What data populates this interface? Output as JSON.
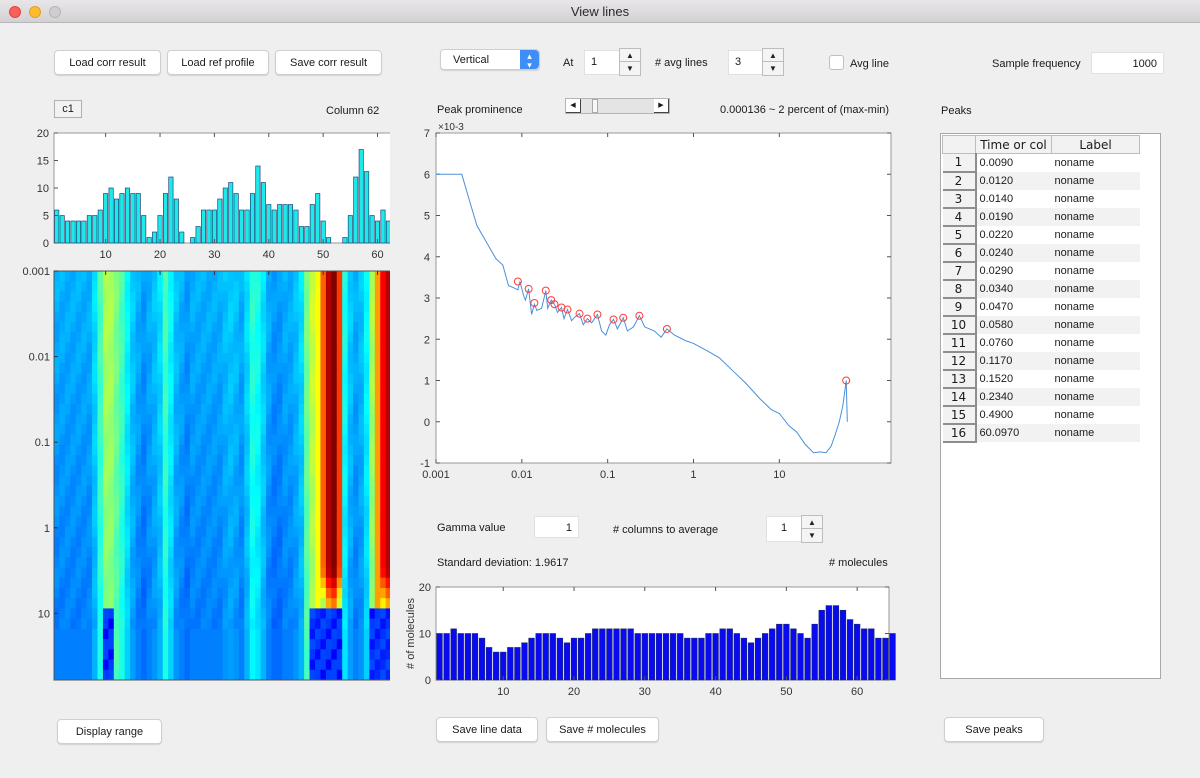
{
  "window": {
    "title": "View lines"
  },
  "toolbar": {
    "load_corr_label": "Load corr result",
    "load_ref_label": "Load ref profile",
    "save_corr_label": "Save corr result",
    "direction_select": "Vertical",
    "at_label": "At",
    "at_value": "1",
    "avg_lines_label": "# avg lines",
    "avg_lines_value": "3",
    "avg_line_checkbox_label": "Avg line",
    "avg_line_checked": false,
    "sample_freq_label": "Sample frequency",
    "sample_freq_value": "1000"
  },
  "left_panel": {
    "channel_badge": "c1",
    "column_label": "Column 62",
    "display_range_label": "Display range"
  },
  "middle_panel": {
    "peak_prominence_label": "Peak prominence",
    "peak_prominence_slider_fraction": 0.15,
    "prominence_readout": "0.000136 ~ 2 percent of (max-min)",
    "gamma_label": "Gamma value",
    "gamma_value": "1",
    "columns_avg_label": "# columns to average",
    "columns_avg_value": "1",
    "std_label": "Standard deviation: 1.9617",
    "molecules_label": "# molecules",
    "save_line_data_label": "Save line data",
    "save_molecules_label": "Save # molecules"
  },
  "peaks_panel": {
    "title": "Peaks",
    "columns": [
      "Time or col",
      "Label"
    ],
    "rows": [
      {
        "n": "1",
        "time": "0.0090",
        "label": "noname"
      },
      {
        "n": "2",
        "time": "0.0120",
        "label": "noname"
      },
      {
        "n": "3",
        "time": "0.0140",
        "label": "noname"
      },
      {
        "n": "4",
        "time": "0.0190",
        "label": "noname"
      },
      {
        "n": "5",
        "time": "0.0220",
        "label": "noname"
      },
      {
        "n": "6",
        "time": "0.0240",
        "label": "noname"
      },
      {
        "n": "7",
        "time": "0.0290",
        "label": "noname"
      },
      {
        "n": "8",
        "time": "0.0340",
        "label": "noname"
      },
      {
        "n": "9",
        "time": "0.0470",
        "label": "noname"
      },
      {
        "n": "10",
        "time": "0.0580",
        "label": "noname"
      },
      {
        "n": "11",
        "time": "0.0760",
        "label": "noname"
      },
      {
        "n": "12",
        "time": "0.1170",
        "label": "noname"
      },
      {
        "n": "13",
        "time": "0.1520",
        "label": "noname"
      },
      {
        "n": "14",
        "time": "0.2340",
        "label": "noname"
      },
      {
        "n": "15",
        "time": "0.4900",
        "label": "noname"
      },
      {
        "n": "16",
        "time": "60.0970",
        "label": "noname"
      }
    ],
    "save_peaks_label": "Save peaks"
  },
  "chart_data": [
    {
      "id": "top-histogram",
      "type": "bar",
      "title": "",
      "xlabel": "",
      "ylabel": "",
      "xlim": [
        0.5,
        64.5
      ],
      "ylim": [
        0,
        20
      ],
      "xticks": [
        10,
        20,
        30,
        40,
        50,
        60
      ],
      "yticks": [
        0,
        5,
        10,
        15,
        20
      ],
      "color": "#1ee8e8",
      "values": [
        6,
        5,
        4,
        4,
        4,
        4,
        5,
        5,
        6,
        9,
        10,
        8,
        9,
        10,
        9,
        9,
        5,
        1,
        2,
        5,
        9,
        12,
        8,
        2,
        0,
        1,
        3,
        6,
        6,
        6,
        8,
        10,
        11,
        9,
        6,
        6,
        9,
        14,
        11,
        7,
        6,
        7,
        7,
        7,
        6,
        3,
        3,
        7,
        9,
        4,
        1,
        0,
        0,
        1,
        5,
        12,
        17,
        13,
        5,
        4,
        6,
        4,
        4,
        8,
        12
      ]
    },
    {
      "id": "heatmap",
      "type": "heatmap",
      "colormap": "jet",
      "xlim": [
        0.5,
        64.5
      ],
      "xticks": [
        10,
        20,
        30,
        40,
        50,
        60
      ],
      "ylabel": "",
      "yscale": "log",
      "yticks": [
        "0.001",
        "0.01",
        "0.1",
        "1",
        "10"
      ],
      "ylim": [
        0.001,
        60
      ],
      "column_profile": [
        0.3,
        0.3,
        0.3,
        0.3,
        0.3,
        0.3,
        0.3,
        0.35,
        0.45,
        0.55,
        0.55,
        0.5,
        0.45,
        0.38,
        0.33,
        0.3,
        0.28,
        0.3,
        0.32,
        0.35,
        0.45,
        0.38,
        0.32,
        0.3,
        0.28,
        0.3,
        0.3,
        0.3,
        0.3,
        0.3,
        0.3,
        0.32,
        0.33,
        0.32,
        0.3,
        0.35,
        0.42,
        0.4,
        0.35,
        0.3,
        0.28,
        0.28,
        0.3,
        0.3,
        0.32,
        0.35,
        0.5,
        0.58,
        0.62,
        0.78,
        0.95,
        1.0,
        0.82,
        0.4,
        0.33,
        0.3,
        0.32,
        0.38,
        0.55,
        0.72,
        0.88,
        0.95,
        0.9,
        0.8
      ]
    },
    {
      "id": "line-profile",
      "type": "line",
      "xscale": "log",
      "xlim": [
        0.001,
        200
      ],
      "ylim": [
        -1,
        7
      ],
      "y_multiplier": "×10^-3",
      "xticks": [
        "0.001",
        "0.01",
        "0.1",
        "1",
        "10"
      ],
      "yticks": [
        -1,
        0,
        1,
        2,
        3,
        4,
        5,
        6,
        7
      ],
      "line_color": "#4a90d9",
      "marker_color": "#ff3b3b",
      "points": [
        [
          0.001,
          6.0
        ],
        [
          0.002,
          6.0
        ],
        [
          0.0025,
          5.3
        ],
        [
          0.003,
          4.75
        ],
        [
          0.004,
          4.3
        ],
        [
          0.005,
          3.95
        ],
        [
          0.006,
          3.8
        ],
        [
          0.007,
          3.3
        ],
        [
          0.008,
          3.25
        ],
        [
          0.009,
          3.2
        ],
        [
          0.0095,
          3.4
        ],
        [
          0.0105,
          3.05
        ],
        [
          0.011,
          2.95
        ],
        [
          0.012,
          3.22
        ],
        [
          0.013,
          2.6
        ],
        [
          0.014,
          2.85
        ],
        [
          0.015,
          2.7
        ],
        [
          0.017,
          2.75
        ],
        [
          0.019,
          3.18
        ],
        [
          0.02,
          2.75
        ],
        [
          0.022,
          2.95
        ],
        [
          0.024,
          2.85
        ],
        [
          0.026,
          2.65
        ],
        [
          0.029,
          2.77
        ],
        [
          0.031,
          2.5
        ],
        [
          0.034,
          2.72
        ],
        [
          0.038,
          2.45
        ],
        [
          0.042,
          2.55
        ],
        [
          0.047,
          2.62
        ],
        [
          0.052,
          2.35
        ],
        [
          0.058,
          2.5
        ],
        [
          0.065,
          2.4
        ],
        [
          0.076,
          2.6
        ],
        [
          0.085,
          2.2
        ],
        [
          0.095,
          2.1
        ],
        [
          0.105,
          2.35
        ],
        [
          0.117,
          2.48
        ],
        [
          0.13,
          2.25
        ],
        [
          0.152,
          2.52
        ],
        [
          0.17,
          2.2
        ],
        [
          0.2,
          2.3
        ],
        [
          0.234,
          2.57
        ],
        [
          0.27,
          2.3
        ],
        [
          0.35,
          2.2
        ],
        [
          0.42,
          2.05
        ],
        [
          0.49,
          2.25
        ],
        [
          0.6,
          2.1
        ],
        [
          0.8,
          1.97
        ],
        [
          1.0,
          1.9
        ],
        [
          1.5,
          1.7
        ],
        [
          2.0,
          1.55
        ],
        [
          3.0,
          1.2
        ],
        [
          4.0,
          0.95
        ],
        [
          6.0,
          0.55
        ],
        [
          8.0,
          0.3
        ],
        [
          10.0,
          0.2
        ],
        [
          13.0,
          -0.1
        ],
        [
          16.0,
          -0.25
        ],
        [
          20.0,
          -0.55
        ],
        [
          25.0,
          -0.75
        ],
        [
          30.0,
          -0.73
        ],
        [
          35.0,
          -0.75
        ],
        [
          40.0,
          -0.6
        ],
        [
          45.0,
          -0.3
        ],
        [
          50.0,
          0.0
        ],
        [
          55.0,
          0.4
        ],
        [
          60.1,
          1.0
        ],
        [
          62.0,
          0.0
        ]
      ],
      "peaks": [
        [
          0.009,
          3.4
        ],
        [
          0.012,
          3.22
        ],
        [
          0.014,
          2.88
        ],
        [
          0.019,
          3.18
        ],
        [
          0.022,
          2.95
        ],
        [
          0.024,
          2.85
        ],
        [
          0.029,
          2.77
        ],
        [
          0.034,
          2.72
        ],
        [
          0.047,
          2.62
        ],
        [
          0.058,
          2.5
        ],
        [
          0.076,
          2.6
        ],
        [
          0.117,
          2.48
        ],
        [
          0.152,
          2.52
        ],
        [
          0.234,
          2.57
        ],
        [
          0.49,
          2.25
        ],
        [
          60.097,
          1.0
        ]
      ]
    },
    {
      "id": "molecules-bar",
      "type": "bar",
      "title": "",
      "xlabel": "",
      "ylabel": "# of molecules",
      "xlim": [
        0.5,
        64.5
      ],
      "ylim": [
        0,
        20
      ],
      "xticks": [
        10,
        20,
        30,
        40,
        50,
        60
      ],
      "yticks": [
        0,
        10,
        20
      ],
      "color": "#0a0af0",
      "values": [
        10,
        10,
        11,
        10,
        10,
        10,
        9,
        7,
        6,
        6,
        7,
        7,
        8,
        9,
        10,
        10,
        10,
        9,
        8,
        9,
        9,
        10,
        11,
        11,
        11,
        11,
        11,
        11,
        10,
        10,
        10,
        10,
        10,
        10,
        10,
        9,
        9,
        9,
        10,
        10,
        11,
        11,
        10,
        9,
        8,
        9,
        10,
        11,
        12,
        12,
        11,
        10,
        9,
        12,
        15,
        16,
        16,
        15,
        13,
        12,
        11,
        11,
        9,
        9,
        10
      ]
    }
  ]
}
